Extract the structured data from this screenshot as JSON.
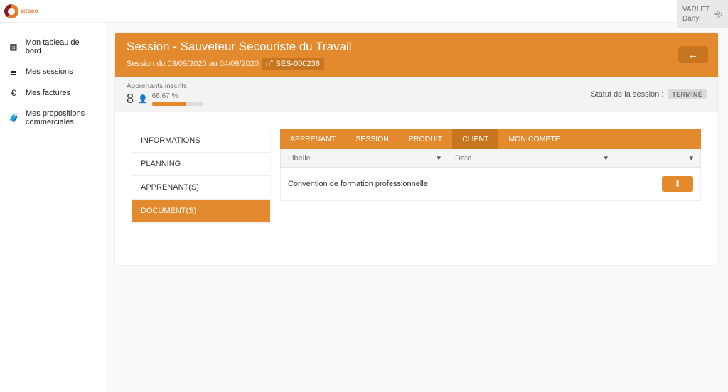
{
  "brand": {
    "name": "sitsco"
  },
  "user": {
    "surname": "VARLET",
    "firstname": "Dany"
  },
  "sidebar": {
    "items": [
      {
        "icon": "dashboard",
        "label": "Mon tableau de bord"
      },
      {
        "icon": "list",
        "label": "Mes sessions"
      },
      {
        "icon": "euro",
        "label": "Mes factures"
      },
      {
        "icon": "briefcase",
        "label": "Mes propositions commerciales"
      }
    ]
  },
  "header": {
    "title": "Session - Sauveteur Secouriste du Travail",
    "subtitle_prefix": "Session du 03/09/2020 au 04/09/2020",
    "session_ref": "n° SES-000236"
  },
  "stats": {
    "label": "Apprenants inscrits",
    "count": "8",
    "percent_text": "66,67 %",
    "progress_pct": 66.67,
    "status_label": "Statut de la session :",
    "status_value": "TERMINÉ"
  },
  "side_tabs": {
    "items": [
      {
        "label": "INFORMATIONS",
        "active": false
      },
      {
        "label": "PLANNING",
        "active": false
      },
      {
        "label": "APPRENANT(S)",
        "active": false
      },
      {
        "label": "DOCUMENT(S)",
        "active": true
      }
    ]
  },
  "category_tabs": {
    "items": [
      {
        "label": "APPRENANT",
        "active": false
      },
      {
        "label": "SESSION",
        "active": false
      },
      {
        "label": "PRODUIT",
        "active": false
      },
      {
        "label": "CLIENT",
        "active": true
      },
      {
        "label": "MON COMPTE",
        "active": false
      }
    ]
  },
  "grid": {
    "columns": {
      "libelle": "Libelle",
      "date": "Date"
    },
    "rows": [
      {
        "libelle": "Convention de formation professionnelle",
        "date": ""
      }
    ]
  },
  "icons": {
    "back_arrow": "←",
    "exit": "⎆",
    "filter": "▾",
    "download": "⬇",
    "person": "👤",
    "dashboard": "▦",
    "list": "≣",
    "euro": "€",
    "briefcase": "🧳"
  }
}
